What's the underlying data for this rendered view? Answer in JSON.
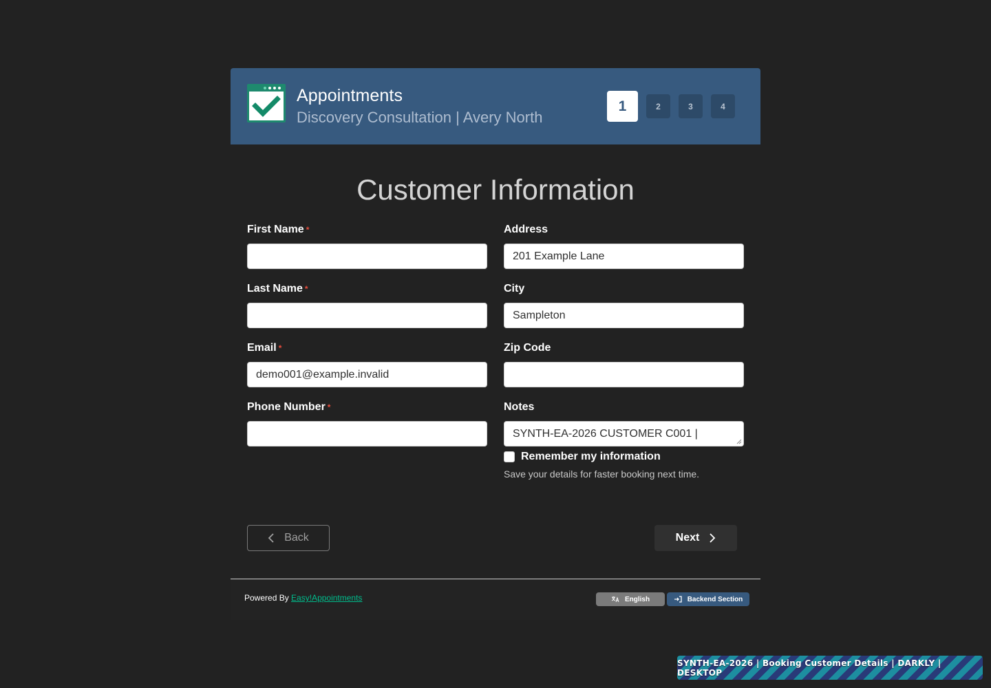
{
  "header": {
    "title": "Appointments",
    "subtitle": "Discovery Consultation | Avery North",
    "logo_icon": "calendar-check-icon",
    "steps": [
      "1",
      "2",
      "3",
      "4"
    ],
    "active_step": "1"
  },
  "section": {
    "title": "Customer Information"
  },
  "form": {
    "first_name": {
      "label": "First Name",
      "required_mark": "*",
      "value": ""
    },
    "last_name": {
      "label": "Last Name",
      "required_mark": "*",
      "value": ""
    },
    "email": {
      "label": "Email",
      "required_mark": "*",
      "value": "demo001@example.invalid"
    },
    "phone": {
      "label": "Phone Number",
      "required_mark": "*",
      "value": ""
    },
    "address": {
      "label": "Address",
      "value": "201 Example Lane"
    },
    "city": {
      "label": "City",
      "value": "Sampleton"
    },
    "zip": {
      "label": "Zip Code",
      "value": ""
    },
    "notes": {
      "label": "Notes",
      "value": "SYNTH-EA-2026 CUSTOMER C001 |"
    },
    "remember": {
      "label": "Remember my information",
      "helper": "Save your details for faster booking next time.",
      "checked": false
    }
  },
  "buttons": {
    "back": "Back",
    "next": "Next"
  },
  "footer": {
    "powered_prefix": "Powered By",
    "powered_link": "Easy!Appointments",
    "language": "English",
    "backend": "Backend Section"
  },
  "badge": {
    "text": "SYNTH-EA-2026 | Booking Customer Details | DARKLY | DESKTOP"
  },
  "colors": {
    "header_bg": "#375a7f",
    "page_bg": "#222222",
    "accent_green": "#00bc8c",
    "required": "#e74c3c"
  }
}
